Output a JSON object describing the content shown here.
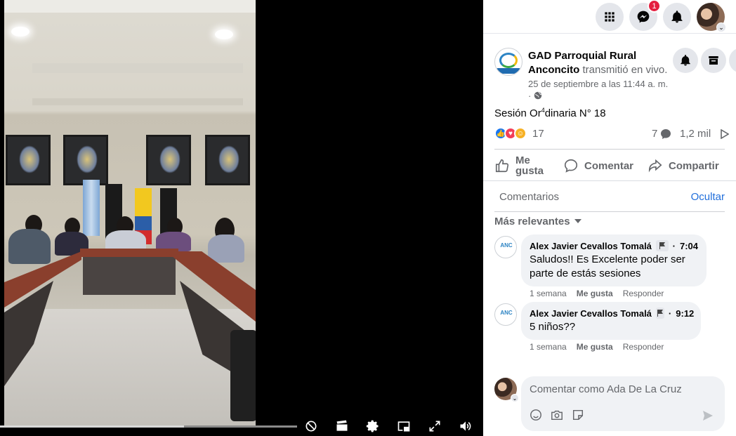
{
  "nav": {
    "menu_icon": "grid-menu-icon",
    "messenger_icon": "messenger-icon",
    "messenger_badge": "1",
    "notifications_icon": "bell-icon",
    "account_icon": "profile-avatar"
  },
  "post": {
    "page_name": "GAD Parroquial Rural Anconcito",
    "action_text": "transmitió en vivo.",
    "timestamp": "25 de septiembre a las 11:44 a. m.",
    "separator": "·",
    "privacy_icon": "globe-icon",
    "text_before": "Sesión Or",
    "text_sup": "4",
    "text_after": "dinaria N° 18",
    "reactions": [
      "like",
      "love",
      "care"
    ],
    "reaction_count": "17",
    "comment_count": "7",
    "views": "1,2 mil"
  },
  "actions": {
    "like": "Me gusta",
    "comment": "Comentar",
    "share": "Compartir"
  },
  "comments_section": {
    "title": "Comentarios",
    "hide": "Ocultar",
    "sort": "Más relevantes",
    "items": [
      {
        "author": "Alex Javier Cevallos Tomalá",
        "time": "7:04",
        "text": "Saludos!! Es Excelente poder ser parte de estás sesiones",
        "age": "1 semana",
        "like": "Me gusta",
        "reply": "Responder",
        "avatar_text": "ANC"
      },
      {
        "author": "Alex Javier Cevallos Tomalá",
        "time": "9:12",
        "text": "5 niños??",
        "age": "1 semana",
        "like": "Me gusta",
        "reply": "Responder",
        "avatar_text": "ANC"
      }
    ]
  },
  "composer": {
    "placeholder": "Comentar como Ada De La Cruz"
  },
  "video": {
    "progress_percent": 62,
    "controls": [
      "captions-off-icon",
      "clapper-icon",
      "settings-icon",
      "picture-in-picture-icon",
      "fullscreen-icon",
      "volume-icon"
    ]
  },
  "colors": {
    "accent": "#1877f2",
    "link": "#216fdb",
    "badge": "#e41e3f"
  }
}
